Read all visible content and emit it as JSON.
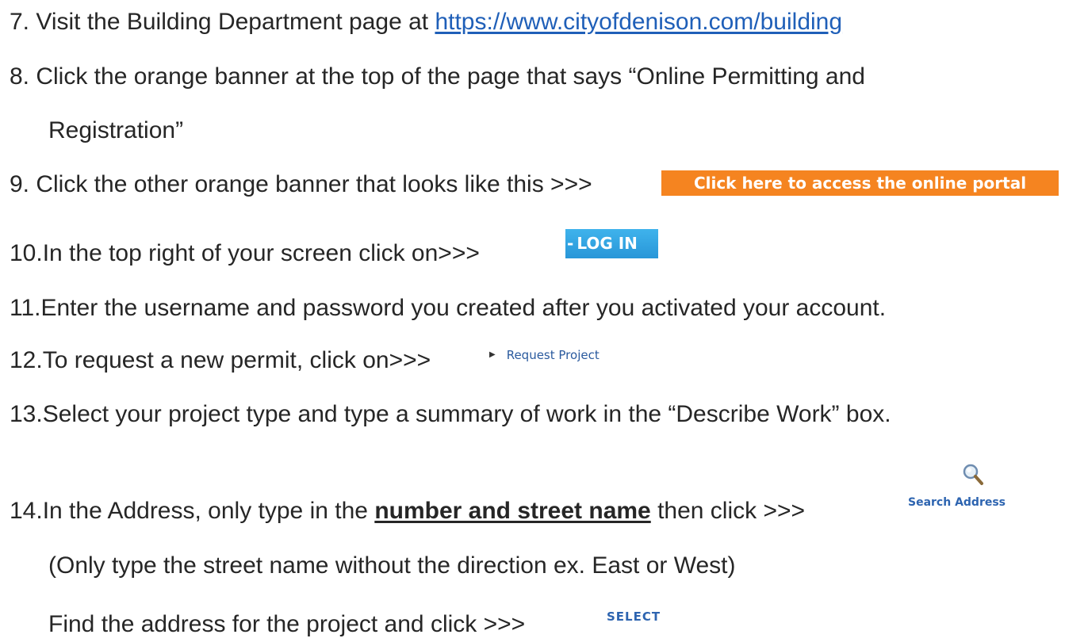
{
  "steps": {
    "s7": {
      "prefix": "7. Visit the Building Department page at ",
      "link": "https://www.cityofdenison.com/building"
    },
    "s8": {
      "line1": "8. Click the orange banner at the top of the page that says “Online Permitting and",
      "line2": "Registration”"
    },
    "s9": {
      "text": "9. Click the other orange banner that looks like this >>>",
      "banner": "Click here to access the online portal"
    },
    "s10": {
      "text": "10.In the top right of your screen click on>>>",
      "button_dash": "-",
      "button": "LOG IN"
    },
    "s11": {
      "text": "11.Enter the username and password you created after you activated your account."
    },
    "s12": {
      "text": "12.To request a new permit, click on>>>",
      "marker": "▶",
      "link": "Request Project"
    },
    "s13": {
      "text": "13.Select your project type and type a summary of work in the “Describe Work” box."
    },
    "s14": {
      "prefix": "14.In the Address, only type in the ",
      "emphasis": "number and street name",
      "suffix": " then click >>>",
      "search_icon": "magnifier-icon",
      "search_label": "Search Address",
      "note": "(Only type the street name without the direction ex. East or West)",
      "find_text": "Find the address for the project and click >>>",
      "select_label": "SELECT"
    }
  },
  "colors": {
    "banner": "#f58420",
    "login": "#2896d8",
    "link": "#1f5fb8"
  }
}
